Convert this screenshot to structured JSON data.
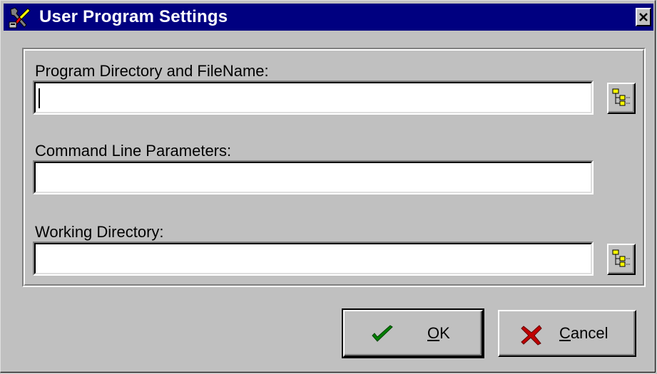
{
  "window": {
    "title": "User Program Settings",
    "icon": "tools-icon",
    "close_icon": "close-icon"
  },
  "fields": [
    {
      "label": "Program Directory and FileName:",
      "value": "",
      "browse_icon": "folder-tree-icon"
    },
    {
      "label": "Command Line Parameters:",
      "value": ""
    },
    {
      "label": "Working Directory:",
      "value": "",
      "browse_icon": "folder-tree-icon"
    }
  ],
  "buttons": {
    "ok": {
      "mnemonic": "O",
      "rest": "K",
      "icon": "checkmark-icon",
      "icon_color": "#008000"
    },
    "cancel": {
      "mnemonic": "C",
      "rest": "ancel",
      "icon": "x-icon",
      "icon_color": "#c00000"
    }
  },
  "colors": {
    "titlebar": "#000080",
    "face": "#c0c0c0"
  }
}
